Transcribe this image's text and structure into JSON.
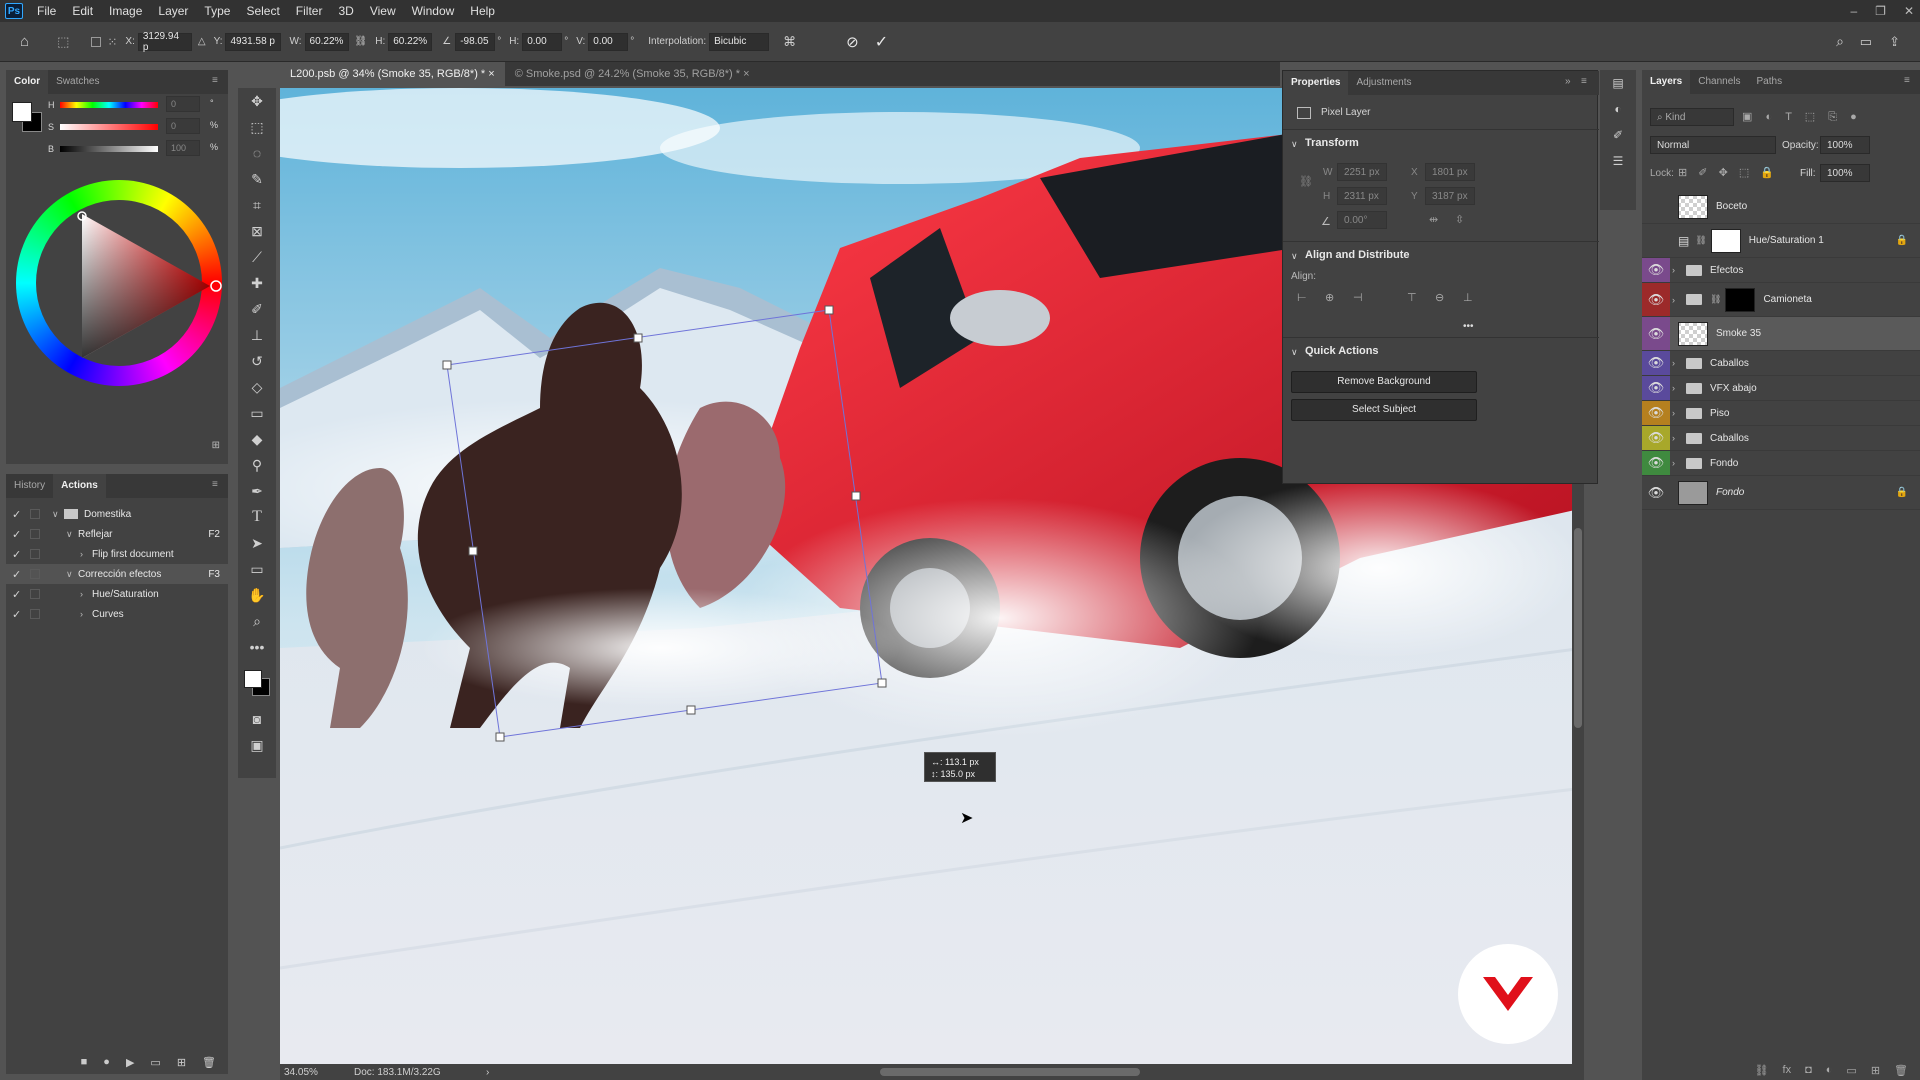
{
  "app": {
    "logo": "Ps"
  },
  "menu": [
    "File",
    "Edit",
    "Image",
    "Layer",
    "Type",
    "Select",
    "Filter",
    "3D",
    "View",
    "Window",
    "Help"
  ],
  "window_controls": {
    "minimize": "–",
    "restore": "❐",
    "close": "✕"
  },
  "options_bar": {
    "x_label": "X:",
    "x_value": "3129.94 p",
    "y_label": "Y:",
    "y_value": "4931.58 p",
    "w_label": "W:",
    "w_value": "60.22%",
    "h_label": "H:",
    "h_value": "60.22%",
    "angle_value": "-98.05",
    "deg": "°",
    "hskew_label": "H:",
    "hskew_value": "0.00",
    "vskew_label": "V:",
    "vskew_value": "0.00",
    "interp_label": "Interpolation:",
    "interp_value": "Bicubic"
  },
  "color_panel": {
    "tabs": [
      "Color",
      "Swatches"
    ],
    "h_label": "H",
    "s_label": "S",
    "b_label": "B",
    "h_value": "0",
    "s_value": "0",
    "b_value": "100",
    "h_unit": "°",
    "s_unit": "%",
    "b_unit": "%"
  },
  "actions_panel": {
    "tabs": [
      "History",
      "Actions"
    ],
    "items": [
      {
        "label": "Domestika",
        "indent": 0,
        "key": ""
      },
      {
        "label": "Reflejar",
        "indent": 1,
        "key": "F2"
      },
      {
        "label": "Flip first document",
        "indent": 2,
        "key": ""
      },
      {
        "label": "Corrección efectos",
        "indent": 1,
        "key": "F3"
      },
      {
        "label": "Hue/Saturation",
        "indent": 2,
        "key": ""
      },
      {
        "label": "Curves",
        "indent": 2,
        "key": ""
      }
    ]
  },
  "doc_tabs": [
    {
      "label": "L200.psb @ 34% (Smoke 35, RGB/8*) *",
      "close": "×"
    },
    {
      "label": "© Smoke.psd @ 24.2% (Smoke 35, RGB/8*) *",
      "close": "×"
    }
  ],
  "transform_tooltip": {
    "line1": "↔: 113.1 px",
    "line2": "↕: 135.0 px"
  },
  "status_bar": {
    "zoom": "34.05%",
    "doc": "Doc: 183.1M/3.22G"
  },
  "properties": {
    "tabs": [
      "Properties",
      "Adjustments"
    ],
    "layer_type": "Pixel Layer",
    "transform_title": "Transform",
    "w_label": "W",
    "w_value": "2251 px",
    "x_label": "X",
    "x_value": "1801 px",
    "h_label": "H",
    "h_value": "2311 px",
    "y_label": "Y",
    "y_value": "3187 px",
    "angle_value": "0.00°",
    "align_title": "Align and Distribute",
    "align_label": "Align:",
    "more": "•••",
    "quick_title": "Quick Actions",
    "btn_remove_bg": "Remove Background",
    "btn_select_subject": "Select Subject"
  },
  "layers_panel": {
    "tabs": [
      "Layers",
      "Channels",
      "Paths"
    ],
    "kind": "Kind",
    "blend_mode": "Normal",
    "opacity_label": "Opacity:",
    "opacity_value": "100%",
    "lock_label": "Lock:",
    "fill_label": "Fill:",
    "fill_value": "100%",
    "layers": [
      {
        "name": "Boceto",
        "type": "pixel",
        "eye": false,
        "color": "#424242"
      },
      {
        "name": "Hue/Saturation 1",
        "type": "adjust",
        "eye": false,
        "color": "#424242"
      },
      {
        "name": "Efectos",
        "type": "group",
        "eye": true,
        "color": "#7a4a8c"
      },
      {
        "name": "Camioneta",
        "type": "group-mask",
        "eye": true,
        "color": "#9c2a2a"
      },
      {
        "name": "Smoke 35",
        "type": "pixel",
        "eye": true,
        "color": "#7a4a8c",
        "selected": true
      },
      {
        "name": "Caballos",
        "type": "group",
        "eye": true,
        "color": "#5a4a9c"
      },
      {
        "name": "VFX abajo",
        "type": "group",
        "eye": true,
        "color": "#5a4a9c"
      },
      {
        "name": "Piso",
        "type": "group",
        "eye": true,
        "color": "#b5801f"
      },
      {
        "name": "Caballos",
        "type": "group",
        "eye": true,
        "color": "#a8a82a"
      },
      {
        "name": "Fondo",
        "type": "group",
        "eye": true,
        "color": "#3f8a3f"
      },
      {
        "name": "Fondo",
        "type": "locked",
        "eye": true,
        "color": "#424242"
      }
    ]
  }
}
